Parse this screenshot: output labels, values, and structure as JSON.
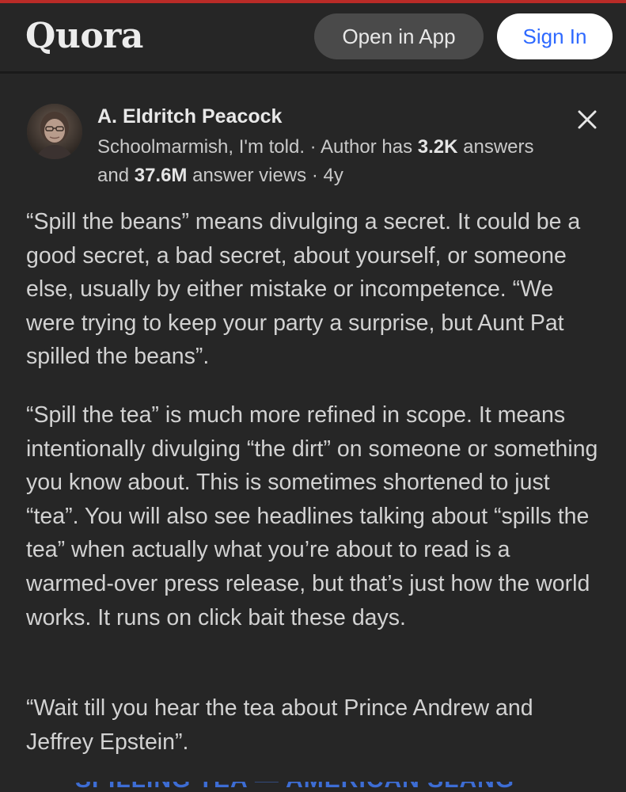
{
  "header": {
    "logo_text": "Quora",
    "open_in_app_label": "Open in App",
    "sign_in_label": "Sign In",
    "accent_color": "#b92b27",
    "sign_in_text_color": "#2e69ff"
  },
  "author": {
    "name": "A. Eldritch Peacock",
    "credential": "Schoolmarmish, I'm told.",
    "answers_prefix": "· Author has ",
    "answers_count": "3.2K",
    "answers_suffix": " answers",
    "views_prefix": "and ",
    "views_count": "37.6M",
    "views_suffix": " answer views",
    "age": "· 4y"
  },
  "answer": {
    "paragraphs": [
      "“Spill the beans” means divulging a secret. It could be a good secret, a bad secret, about yourself, or someone else, usually by either mistake or incompetence. “We were trying to keep your party a surprise, but Aunt Pat spilled the beans”.",
      "“Spill the tea” is much more refined in scope. It means intentionally divulging “the dirt” on someone or something you know about. This is sometimes shortened to just “tea”. You will also see headlines talking about “spills the tea” when actually what you’re about to read is a warmed-over press release, but that’s just how the world works. It runs on click bait these days.",
      "“Wait till you hear the tea about Prince Andrew and Jeffrey Epstein”."
    ]
  },
  "footer": {
    "partial_link_text": "SPILLING TEA — AMERICAN SLANG"
  },
  "icons": {
    "close": "close-icon",
    "avatar": "author-avatar"
  }
}
